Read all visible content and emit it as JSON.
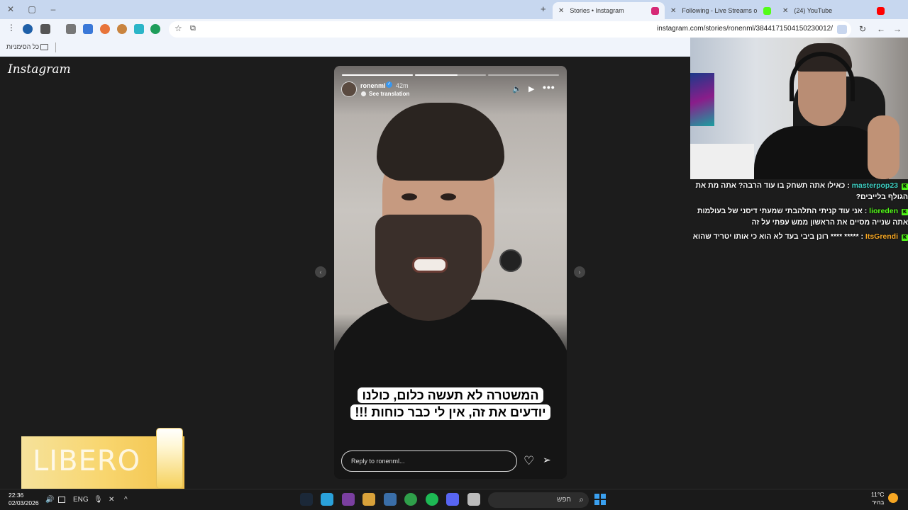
{
  "tabs": [
    {
      "label": "Stories • Instagram",
      "favicon_color": "#d62976",
      "active": true
    },
    {
      "label": "Following - Live Streams on Kick",
      "favicon_color": "#53fc18",
      "active": false
    },
    {
      "label": "(24) YouTube",
      "favicon_color": "#ff0000",
      "active": false
    }
  ],
  "toolbar": {
    "url": "instagram.com/stories/ronenml/3844171504150230012/"
  },
  "bookmarks": {
    "all_bookmarks_label": "כל הסימניות"
  },
  "instagram": {
    "logo": "Instagram"
  },
  "story": {
    "username": "ronenml",
    "time_ago": "42m",
    "translation_label": "See translation",
    "caption": "המשטרה לא תעשה כלום, כולנו יודעים את זה, אין לי כבר כוחות !!!",
    "reply_placeholder": "Reply to ronenml...",
    "progress": [
      1.0,
      0.6,
      0.0
    ]
  },
  "chat": {
    "messages": [
      {
        "user": "masterpop23",
        "user_color": "#3dcfc3",
        "text": "כאילו אתה תשחק בו עוד הרבה? אתה מת את הגולף בלייבים?"
      },
      {
        "user": "lioreden",
        "user_color": "#53fc18",
        "text": "אני עוד קניתי התלהבתי שמעתי דיסני של בעולמות אתה שנייה מסיים את הראשון ממש עפתי על זה"
      },
      {
        "user": "ItsGrendi",
        "user_color": "#f5a623",
        "text": "***** **** רונן ביבי בעד לא הוא כי אותו יטריד שהוא"
      }
    ]
  },
  "ad": {
    "brand": "LIBERO"
  },
  "taskbar": {
    "time": "22:36",
    "date": "02/03/2026",
    "lang": "ENG",
    "search_label": "חפש",
    "temperature": "11°C",
    "weather_desc": "בהיר"
  }
}
